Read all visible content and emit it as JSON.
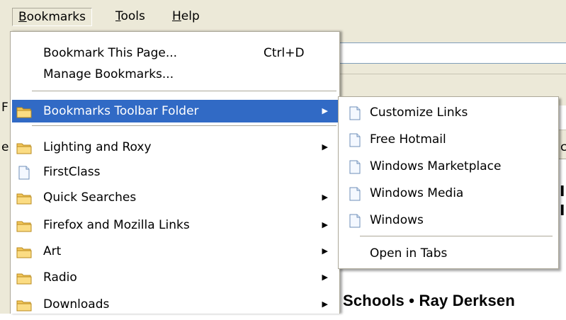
{
  "menubar": {
    "items": [
      "Bookmarks",
      "Tools",
      "Help"
    ],
    "mnemonics": [
      "B",
      "T",
      "H"
    ]
  },
  "background": {
    "frag_f": "F",
    "frag_e": "e",
    "frag_c": "c",
    "schools_text": "Schools • Ray Derksen",
    "bold_frag1": "I",
    "bold_frag2": "I"
  },
  "bookmarks_menu": {
    "bookmark_this_page": "Bookmark This Page...",
    "bookmark_shortcut": "Ctrl+D",
    "manage_bookmarks": "Manage Bookmarks...",
    "items": [
      {
        "label": "Bookmarks Toolbar Folder",
        "icon": "folder-icon",
        "submenu": true,
        "highlighted": true
      },
      {
        "label": "Lighting and Roxy",
        "icon": "folder-icon",
        "submenu": true
      },
      {
        "label": "FirstClass",
        "icon": "page-icon",
        "submenu": false
      },
      {
        "label": "Quick Searches",
        "icon": "folder-icon",
        "submenu": true
      },
      {
        "label": "Firefox and Mozilla Links",
        "icon": "folder-icon",
        "submenu": true
      },
      {
        "label": "Art",
        "icon": "folder-icon",
        "submenu": true
      },
      {
        "label": "Radio",
        "icon": "folder-icon",
        "submenu": true
      },
      {
        "label": "Downloads",
        "icon": "folder-icon",
        "submenu": true
      }
    ]
  },
  "toolbar_folder_submenu": {
    "items": [
      {
        "label": "Customize Links",
        "icon": "page-icon"
      },
      {
        "label": "Free Hotmail",
        "icon": "page-icon"
      },
      {
        "label": "Windows Marketplace",
        "icon": "page-icon"
      },
      {
        "label": "Windows Media",
        "icon": "page-icon"
      },
      {
        "label": "Windows",
        "icon": "page-icon"
      }
    ],
    "open_in_tabs": "Open in Tabs"
  },
  "colors": {
    "highlight": "#316ac5",
    "menubar_bg": "#ece9d8",
    "folder": "#f3c75a"
  }
}
